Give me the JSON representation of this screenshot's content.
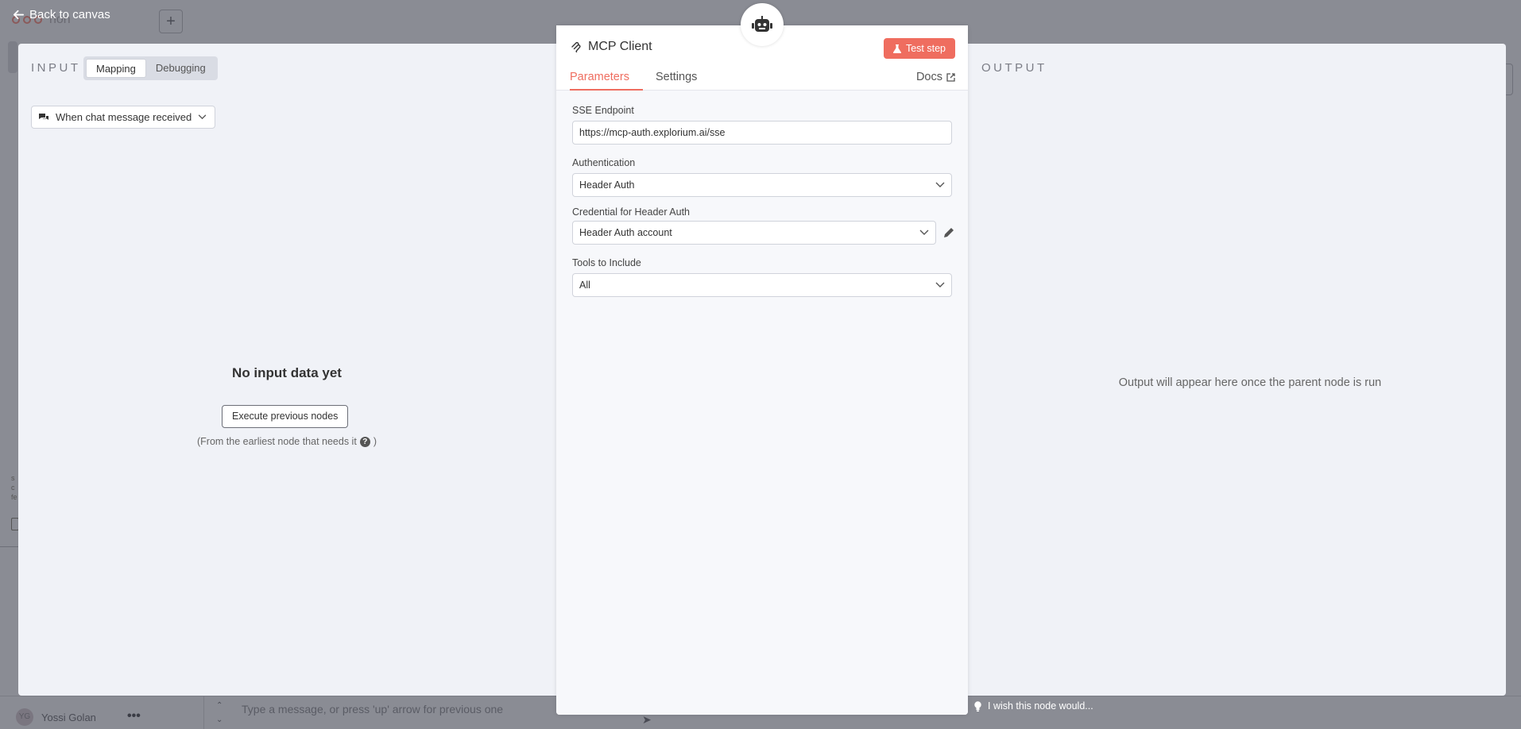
{
  "colors": {
    "accent": "#ef6d5f",
    "overlay": "#8a8c94",
    "panel": "#f0f2f7"
  },
  "nav": {
    "back_label": "Back to canvas"
  },
  "background": {
    "workflow_name": "rion",
    "user_initials": "YG",
    "user_name": "Yossi Golan",
    "chat_placeholder": "Type a message, or press 'up' arrow for previous one"
  },
  "input": {
    "heading": "INPUT",
    "mode_tabs": [
      "Mapping",
      "Debugging"
    ],
    "active_mode": "Mapping",
    "source_node": "When chat message received",
    "empty_title": "No input data yet",
    "execute_label": "Execute previous nodes",
    "hint_prefix": "(From the earliest node that needs it",
    "hint_suffix": ")"
  },
  "node": {
    "title": "MCP Client",
    "icon": "robot-icon",
    "test_label": "Test step",
    "tabs": {
      "parameters": "Parameters",
      "settings": "Settings",
      "docs": "Docs"
    },
    "fields": {
      "sse_endpoint": {
        "label": "SSE Endpoint",
        "value": "https://mcp-auth.explorium.ai/sse"
      },
      "authentication": {
        "label": "Authentication",
        "value": "Header Auth"
      },
      "credential": {
        "label": "Credential for Header Auth",
        "value": "Header Auth account"
      },
      "tools": {
        "label": "Tools to Include",
        "value": "All"
      }
    }
  },
  "output": {
    "heading": "OUTPUT",
    "empty_message": "Output will appear here once the parent node is run"
  },
  "feedback": {
    "label": "I wish this node would..."
  }
}
